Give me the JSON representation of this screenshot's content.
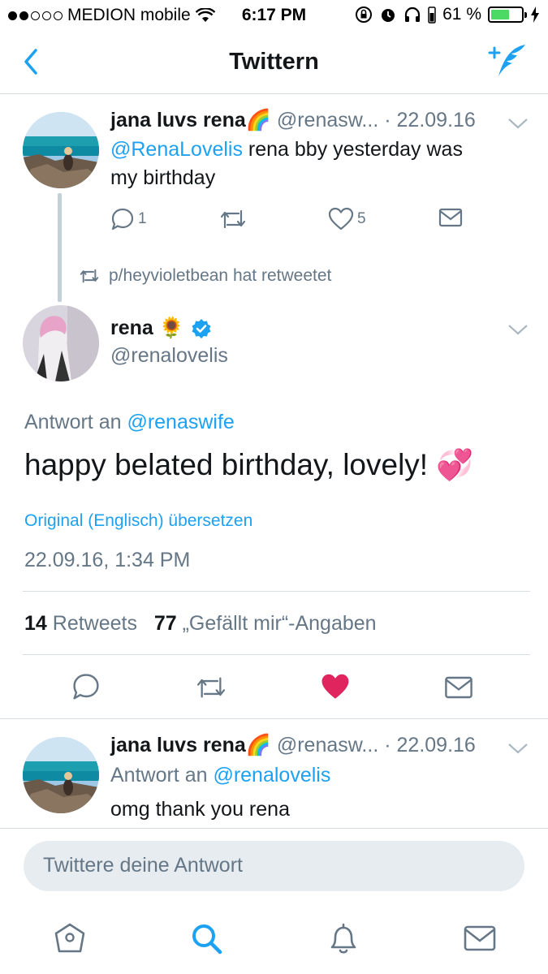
{
  "status_bar": {
    "carrier": "MEDION mobile",
    "time": "6:17 PM",
    "battery": "61 %",
    "battery_level": 0.61
  },
  "nav": {
    "title": "Twittern"
  },
  "parent_tweet": {
    "name": "jana luvs rena🌈",
    "handle": "@renasw...",
    "date": "· 22.09.16",
    "mention": "@RenaLovelis",
    "text_line1": " rena bby yesterday was",
    "text_line2": "my birthday",
    "replies": "1",
    "likes": "5"
  },
  "retweet_note": "p/heyvioletbean hat retweetet",
  "main_tweet": {
    "name": "rena 🌻",
    "handle": "@renalovelis",
    "reply_prefix": "Antwort an ",
    "reply_to": "@renaswife",
    "text": "happy belated birthday, lovely! 💞",
    "translate": "Original (Englisch) übersetzen",
    "timestamp": "22.09.16, 1:34 PM",
    "retweets_count": "14",
    "retweets_label": "Retweets",
    "likes_count": "77",
    "likes_label": "„Gefällt mir“-Angaben",
    "liked_color": "#e0245e"
  },
  "reply_tweet": {
    "name": "jana luvs rena🌈",
    "handle": "@renasw...",
    "date": "· 22.09.16",
    "reply_prefix": "Antwort an ",
    "reply_to": "@renalovelis",
    "text": "omg thank you rena"
  },
  "reply_input": {
    "placeholder": "Twittere deine Antwort"
  },
  "colors": {
    "accent": "#1da1f2",
    "muted": "#657786",
    "like": "#e0245e"
  },
  "tab_bar": {
    "icons": [
      "home-icon",
      "search-icon",
      "notifications-icon",
      "messages-icon"
    ]
  }
}
